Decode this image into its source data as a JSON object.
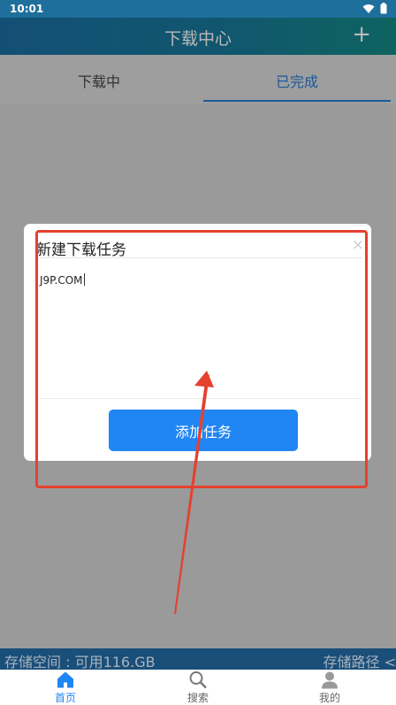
{
  "status_bar": {
    "time": "10:01"
  },
  "app_bar": {
    "title": "下载中心",
    "add_label": "+"
  },
  "tabs": [
    {
      "label": "下载中"
    },
    {
      "label": "已完成"
    }
  ],
  "dialog": {
    "title": "新建下载任务",
    "close_label": "×",
    "input_value": "J9P.COM",
    "button_label": "添加任务"
  },
  "storage": {
    "left_text": "存储空间 : 可用116.GB",
    "right_text": "存储路径 <"
  },
  "bottom_nav": [
    {
      "label": "首页",
      "icon": "home-icon"
    },
    {
      "label": "搜索",
      "icon": "search-icon"
    },
    {
      "label": "我的",
      "icon": "person-icon"
    }
  ],
  "colors": {
    "accent": "#1f86f3",
    "annotation": "#e4412f"
  }
}
